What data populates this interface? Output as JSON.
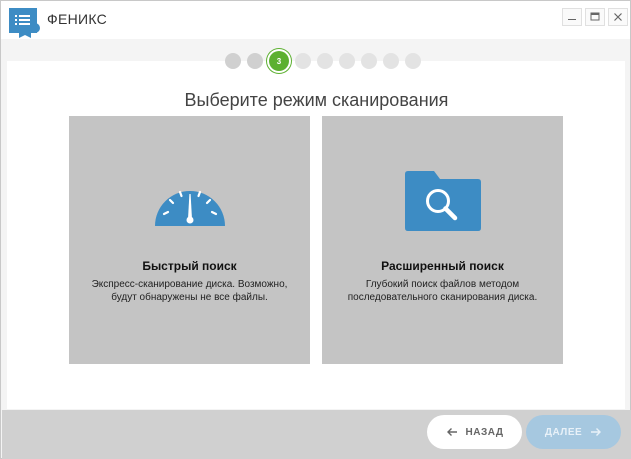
{
  "window": {
    "title": "ФЕНИКС",
    "logo_icon": "list-gear-icon",
    "controls": [
      "minimize-icon",
      "maximize-icon",
      "close-icon"
    ]
  },
  "steps": {
    "total": 9,
    "current": 3,
    "current_label": "3"
  },
  "heading": "Выберите режим сканирования",
  "options": [
    {
      "icon": "speedometer-icon",
      "title": "Быстрый поиск",
      "description": "Экспресс-сканирование диска. Возможно, будут обнаружены не все файлы."
    },
    {
      "icon": "folder-search-icon",
      "title": "Расширенный поиск",
      "description": "Глубокий поиск файлов методом последовательного сканирования диска."
    }
  ],
  "nav": {
    "back_label": "НАЗАД",
    "next_label": "ДАЛЕЕ",
    "next_enabled": false
  },
  "colors": {
    "accent_blue": "#3d8cc4",
    "step_active": "#5cb030",
    "card_bg": "#c4c4c4",
    "next_disabled": "#a6c8e0"
  }
}
